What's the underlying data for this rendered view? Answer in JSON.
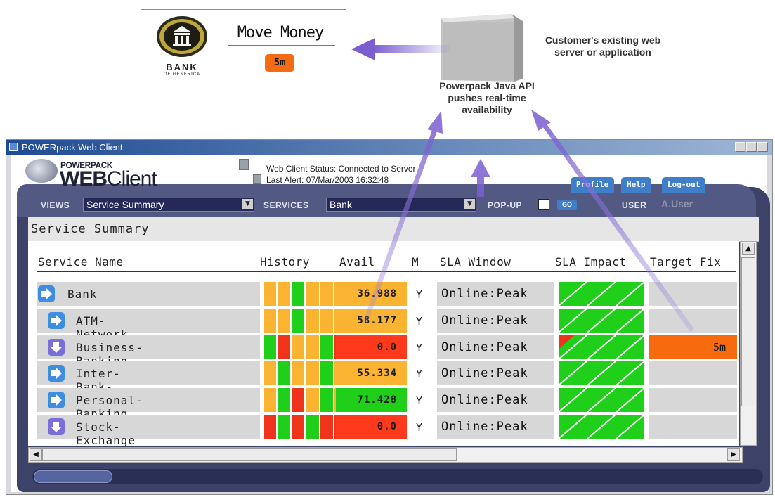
{
  "bank_widget": {
    "bank_name": "BANK",
    "bank_subtitle": "OF GENERICA",
    "title": "Move Money",
    "time_badge": "5m"
  },
  "captions": {
    "server": "Customer's existing web server or application",
    "server_line1": "Customer's existing web",
    "server_line2": "server or application",
    "api_line1": "Powerpack Java API",
    "api_line2": "pushes real-time",
    "api_line3": "availability"
  },
  "window": {
    "title": "POWERpack Web Client"
  },
  "app": {
    "logo_small": "POWERPACK",
    "logo_big_bold": "WEB",
    "logo_big_rest": "Client",
    "status_line1": "Web Client Status: Connected to Server",
    "status_line2": "Last Alert: 07/Mar/2003 16:32:48",
    "tabs": [
      "Profile",
      "Help",
      "Log-out"
    ],
    "views_label": "VIEWS",
    "views_value": "Service Summary",
    "services_label": "SERVICES",
    "services_value": "Bank",
    "popup_label": "POP-UP",
    "go_label": "GO",
    "user_label": "USER",
    "user_value": "A.User"
  },
  "panel": {
    "title": "Service Summary",
    "columns": [
      "Service Name",
      "History",
      "Avail",
      "M",
      "SLA Window",
      "SLA Impact",
      "Target Fix"
    ],
    "rows": [
      {
        "name": "Bank",
        "history": [
          "orange",
          "orange",
          "green",
          "orange",
          "orange",
          "orange"
        ],
        "avail": "36.988",
        "avail_color": "#fbb431",
        "m": "Y",
        "sla_window": "Online:Peak",
        "impact": [
          "green",
          "green",
          "green"
        ],
        "target_fix": "",
        "icon": "arrow-right-icon"
      },
      {
        "name": "ATM-Network",
        "history": [
          "orange",
          "orange",
          "green",
          "orange",
          "orange",
          "orange"
        ],
        "avail": "58.177",
        "avail_color": "#fbb431",
        "m": "Y",
        "sla_window": "Online:Peak",
        "impact": [
          "green",
          "green",
          "green"
        ],
        "target_fix": "",
        "icon": "arrow-right-icon"
      },
      {
        "name": "Business-Banking",
        "history": [
          "green",
          "red",
          "orange",
          "orange",
          "green",
          "red"
        ],
        "avail": "0.0",
        "avail_color": "#ff3a1c",
        "m": "Y",
        "sla_window": "Online:Peak",
        "impact": [
          "red-partial",
          "green",
          "green"
        ],
        "target_fix": "5m",
        "icon": "arrow-down-icon"
      },
      {
        "name": "Inter-Bank-Transfers",
        "history": [
          "orange",
          "green",
          "orange",
          "orange",
          "green",
          "orange"
        ],
        "avail": "55.334",
        "avail_color": "#fbb431",
        "m": "Y",
        "sla_window": "Online:Peak",
        "impact": [
          "green",
          "green",
          "green"
        ],
        "target_fix": "",
        "icon": "arrow-right-icon"
      },
      {
        "name": "Personal-Banking",
        "history": [
          "orange",
          "green",
          "red",
          "orange",
          "green",
          "orange"
        ],
        "avail": "71.428",
        "avail_color": "#1fcf1a",
        "m": "Y",
        "sla_window": "Online:Peak",
        "impact": [
          "green",
          "green",
          "green"
        ],
        "target_fix": "",
        "icon": "arrow-right-icon"
      },
      {
        "name": "Stock-Exchange",
        "history": [
          "red",
          "green",
          "red",
          "green",
          "red",
          "red"
        ],
        "avail": "0.0",
        "avail_color": "#ff3a1c",
        "m": "Y",
        "sla_window": "Online:Peak",
        "impact": [
          "green",
          "green",
          "green"
        ],
        "target_fix": "",
        "icon": "arrow-down-icon"
      }
    ]
  },
  "colors": {
    "orange": "#fbb431",
    "green": "#1fcf1a",
    "red": "#f0331b",
    "target_fix_alert": "#f76b0e",
    "arrow": "#7b5fd0"
  }
}
